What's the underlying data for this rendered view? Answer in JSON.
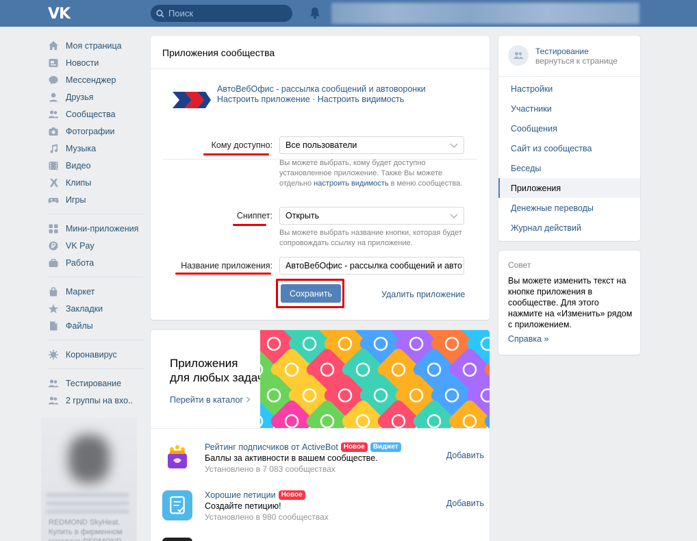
{
  "header": {
    "logo": "VK",
    "search_placeholder": "Поиск"
  },
  "sidebar": {
    "items": [
      {
        "label": "Моя страница",
        "icon": "home-icon"
      },
      {
        "label": "Новости",
        "icon": "news-icon"
      },
      {
        "label": "Мессенджер",
        "icon": "messenger-icon"
      },
      {
        "label": "Друзья",
        "icon": "friends-icon"
      },
      {
        "label": "Сообщества",
        "icon": "communities-icon"
      },
      {
        "label": "Фотографии",
        "icon": "camera-icon"
      },
      {
        "label": "Музыка",
        "icon": "music-icon"
      },
      {
        "label": "Видео",
        "icon": "video-icon"
      },
      {
        "label": "Клипы",
        "icon": "clips-icon"
      },
      {
        "label": "Игры",
        "icon": "gamepad-icon"
      }
    ],
    "items2": [
      {
        "label": "Мини-приложения",
        "icon": "apps-grid-icon"
      },
      {
        "label": "VK Pay",
        "icon": "vkpay-icon"
      },
      {
        "label": "Работа",
        "icon": "briefcase-icon"
      }
    ],
    "items3": [
      {
        "label": "Маркет",
        "icon": "shopping-bag-icon"
      },
      {
        "label": "Закладки",
        "icon": "star-icon"
      },
      {
        "label": "Файлы",
        "icon": "file-icon"
      }
    ],
    "items4": [
      {
        "label": "Коронавирус",
        "icon": "virus-icon"
      }
    ],
    "items5": [
      {
        "label": "Тестирование",
        "icon": "group-icon"
      },
      {
        "label": "2 группы на вхо..",
        "icon": "group-icon"
      }
    ],
    "ad_text": "REDMOND SkyHeat. Купить в фирменном магазине REDMOND"
  },
  "main": {
    "title": "Приложения сообщества",
    "app": {
      "name": "АвтоВебОфис - рассылка сообщений и автоворонки",
      "configure_link": "Настроить приложение",
      "separator": " · ",
      "visibility_link": "Настроить видимость"
    },
    "fields": {
      "access_label": "Кому доступно:",
      "access_value": "Все пользователи",
      "access_hint_1": "Вы можете выбрать, кому будет доступно установленное приложение. Также Вы можете отдельно ",
      "access_hint_link": "настроить видимость",
      "access_hint_2": " в меню сообщества.",
      "snippet_label": "Сниппет:",
      "snippet_value": "Открыть",
      "snippet_hint": "Вы можете выбрать название кнопки, которая будет сопровождать ссылку на приложение.",
      "name_label": "Название приложения:",
      "name_value": "АвтоВебОфис - рассылка сообщений и авто"
    },
    "save_label": "Сохранить",
    "delete_label": "Удалить приложение"
  },
  "catalog": {
    "title_line1": "Приложения",
    "title_line2": "для любых задач",
    "link": "Перейти в каталог",
    "items": [
      {
        "title": "Рейтинг подписчиков от ActiveBot",
        "badges": [
          "Новое",
          "Виджет"
        ],
        "desc": "Баллы за активности в вашем сообществе.",
        "stat": "Установлено в 7 083 сообществах",
        "add": "Добавить"
      },
      {
        "title": "Хорошие петиции",
        "badges": [
          "Новое"
        ],
        "desc": "Создайте петицию!",
        "stat": "Установлено в 980 сообществах",
        "add": "Добавить"
      }
    ]
  },
  "right": {
    "group_name": "Тестирование",
    "back_link": "вернуться к странице",
    "menu": [
      "Настройки",
      "Участники",
      "Сообщения",
      "Сайт из сообщества",
      "Беседы",
      "Приложения",
      "Денежные переводы",
      "Журнал действий"
    ],
    "active_index": 5,
    "tip_title": "Совет",
    "tip_text": "Вы можете изменить текст на кнопке приложения в сообществе. Для этого нажмите на «Изменить» рядом с приложением.",
    "tip_link": "Справка »"
  },
  "colors": {
    "header": "#4a76a8",
    "link": "#2a5885",
    "button": "#5181b8",
    "highlight": "#e00000"
  }
}
